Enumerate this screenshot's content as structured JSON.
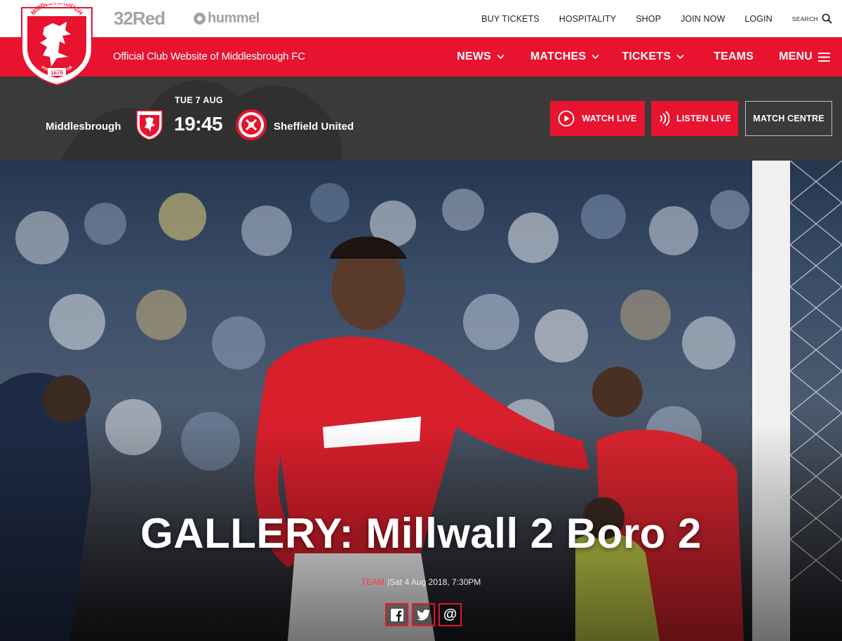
{
  "brand": {
    "crest_top_text": "MIDDLESBROUGH",
    "crest_bottom_text": "FOOTBALL CLUB",
    "crest_year": "1876",
    "tagline": "Official Club Website of Middlesbrough FC",
    "colors": {
      "primary_red": "#e8132f",
      "dark_bar": "#3a3a3a",
      "white": "#ffffff"
    }
  },
  "sponsors": {
    "shirt": "32Red",
    "kit": "hummel"
  },
  "top_links": {
    "buy_tickets": "BUY TICKETS",
    "hospitality": "HOSPITALITY",
    "shop": "SHOP",
    "join_now": "JOIN NOW",
    "login": "LOGIN",
    "search_label": "SEARCH"
  },
  "nav": {
    "news": "NEWS",
    "matches": "MATCHES",
    "tickets": "TICKETS",
    "teams": "TEAMS",
    "menu": "MENU"
  },
  "fixture": {
    "date": "TUE 7 AUG",
    "home_team": "Middlesbrough",
    "kickoff_time": "19:45",
    "away_team": "Sheffield United",
    "watch_live": "WATCH LIVE",
    "listen_live": "LISTEN LIVE",
    "match_centre": "MATCH CENTRE"
  },
  "article": {
    "title": "GALLERY: Millwall 2 Boro 2",
    "category": "TEAM",
    "date": "|Sat 4 Aug 2018, 7:30PM"
  },
  "share": {
    "icons": [
      "facebook-icon",
      "twitter-icon",
      "email-icon"
    ],
    "email_glyph": "@"
  }
}
